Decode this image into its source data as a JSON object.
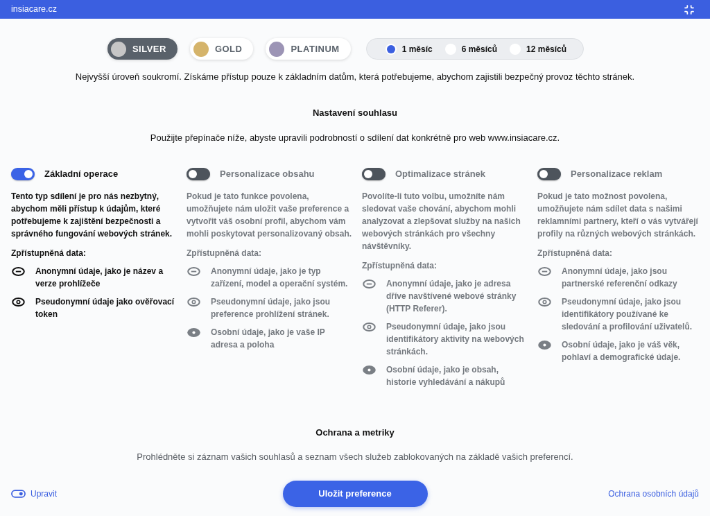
{
  "top_bar": {
    "site": "insiacare.cz"
  },
  "tiers": [
    {
      "label": "SILVER",
      "color": "#c6c6c6",
      "selected": true
    },
    {
      "label": "GOLD",
      "color": "#d5b46b",
      "selected": false
    },
    {
      "label": "PLATINUM",
      "color": "#9c94b5",
      "selected": false
    }
  ],
  "periods": [
    {
      "label": "1 měsíc",
      "selected": true
    },
    {
      "label": "6 měsíců",
      "selected": false
    },
    {
      "label": "12 měsíců",
      "selected": false
    }
  ],
  "tier_description": "Nejvyšší úroveň soukromí. Získáme přístup pouze k základním datům, která potřebujeme, abychom zajistili bezpečný provoz těchto stránek.",
  "consent": {
    "title": "Nastavení souhlasu",
    "subtitle": "Použijte přepínače níže, abyste upravili podrobností o sdílení dat konkrétně pro web www.insiacare.cz."
  },
  "categories": [
    {
      "title": "Základní operace",
      "on": true,
      "description": "Tento typ sdílení je pro nás nezbytný, abychom měli přístup k údajům, které potřebujeme k zajištění bezpečnosti a správného fungování webových stránek.",
      "data_heading": "Zpřístupněná data:",
      "items": [
        {
          "kind": "anonymous",
          "text": "Anonymní údaje, jako je název a verze prohlížeče"
        },
        {
          "kind": "pseudonymous",
          "text": "Pseudonymní údaje jako ověřovací token"
        }
      ]
    },
    {
      "title": "Personalizace obsahu",
      "on": false,
      "description": "Pokud je tato funkce povolena, umožňujete nám uložit vaše preference a vytvořit váš osobní profil, abychom vám mohli poskytovat personalizovaný obsah.",
      "data_heading": "Zpřístupněná data:",
      "items": [
        {
          "kind": "anonymous",
          "text": "Anonymní údaje, jako je typ zařízení, model a operační systém."
        },
        {
          "kind": "pseudonymous",
          "text": "Pseudonymní údaje, jako jsou preference prohlížení stránek."
        },
        {
          "kind": "personal",
          "text": "Osobní údaje, jako je vaše IP adresa a poloha"
        }
      ]
    },
    {
      "title": "Optimalizace stránek",
      "on": false,
      "description": "Povolíte-li tuto volbu, umožníte nám sledovat vaše chování, abychom mohli analyzovat a zlepšovat služby na našich webových stránkách pro všechny návštěvníky.",
      "data_heading": "Zpřístupněná data:",
      "items": [
        {
          "kind": "anonymous",
          "text": "Anonymní údaje, jako je adresa dříve navštívené webové stránky (HTTP Referer)."
        },
        {
          "kind": "pseudonymous",
          "text": "Pseudonymní údaje, jako jsou identifikátory aktivity na webových stránkách."
        },
        {
          "kind": "personal",
          "text": "Osobní údaje, jako je obsah, historie vyhledávání a nákupů"
        }
      ]
    },
    {
      "title": "Personalizace reklam",
      "on": false,
      "description": "Pokud je tato možnost povolena, umožňujete nám sdílet data s našimi reklamními partnery, kteří o vás vytvářejí profily na různých webových stránkách.",
      "data_heading": "Zpřístupněná data:",
      "items": [
        {
          "kind": "anonymous",
          "text": "Anonymní údaje, jako jsou partnerské referenční odkazy"
        },
        {
          "kind": "pseudonymous",
          "text": "Pseudonymní údaje, jako jsou identifikátory používané ke sledování a profilování uživatelů."
        },
        {
          "kind": "personal",
          "text": "Osobní údaje, jako je váš věk, pohlaví a demografické údaje."
        }
      ]
    }
  ],
  "metrics": {
    "title": "Ochrana a metriky",
    "text": "Prohlédněte si záznam vašich souhlasů a seznam všech služeb zablokovaných na základě vašich preferencí."
  },
  "footer": {
    "edit_link": "Upravit",
    "save_button": "Uložit preference",
    "privacy_link": "Ochrana osobních údajů"
  }
}
